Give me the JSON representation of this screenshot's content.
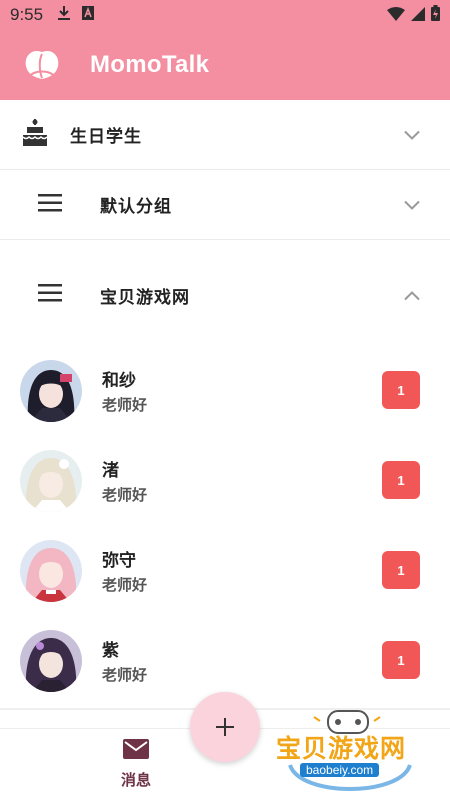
{
  "status": {
    "time": "9:55"
  },
  "app": {
    "title": "MomoTalk",
    "logo_icon": "peach-logo-icon"
  },
  "groups": [
    {
      "label": "生日学生",
      "icon": "cake-icon",
      "expanded": false
    },
    {
      "label": "默认分组",
      "icon": "menu-icon",
      "expanded": false
    },
    {
      "label": "宝贝游戏网",
      "icon": "menu-icon",
      "expanded": true
    }
  ],
  "contacts": [
    {
      "name": "和纱",
      "message": "老师好",
      "unread": "1"
    },
    {
      "name": "渚",
      "message": "老师好",
      "unread": "1"
    },
    {
      "name": "弥守",
      "message": "老师好",
      "unread": "1"
    },
    {
      "name": "紫",
      "message": "老师好",
      "unread": "1"
    }
  ],
  "nav": {
    "messages_label": "消息"
  },
  "fab": {
    "label": "+"
  },
  "watermark": {
    "title": "宝贝游戏网",
    "url": "baobeiy.com"
  },
  "colors": {
    "primary": "#f48ea1",
    "badge": "#f25757",
    "fab": "#fbd3dc",
    "nav_accent": "#6e3346"
  }
}
